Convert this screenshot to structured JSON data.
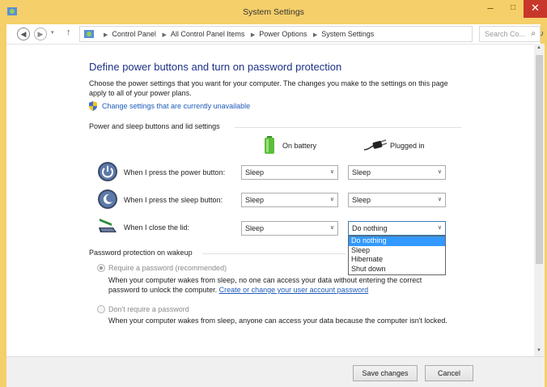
{
  "window": {
    "title": "System Settings",
    "controls": {
      "minimize": "–",
      "maximize": "□",
      "close": "✕"
    }
  },
  "address": {
    "breadcrumbs": [
      "Control Panel",
      "All Control Panel Items",
      "Power Options",
      "System Settings"
    ],
    "search_placeholder": "Search Co..."
  },
  "page": {
    "heading": "Define power buttons and turn on password protection",
    "intro": "Choose the power settings that you want for your computer. The changes you make to the settings on this page apply to all of your power plans.",
    "change_link": "Change settings that are currently unavailable"
  },
  "power_group": {
    "label": "Power and sleep buttons and lid settings",
    "columns": {
      "battery": "On battery",
      "plugged": "Plugged in"
    },
    "rows": [
      {
        "label": "When I press the power button:",
        "icon": "power-button-icon",
        "battery": "Sleep",
        "plugged": "Sleep"
      },
      {
        "label": "When I press the sleep button:",
        "icon": "sleep-button-icon",
        "battery": "Sleep",
        "plugged": "Sleep"
      },
      {
        "label": "When I close the lid:",
        "icon": "laptop-lid-icon",
        "battery": "Sleep",
        "plugged": "Do nothing"
      }
    ],
    "open_dropdown": {
      "options": [
        "Do nothing",
        "Sleep",
        "Hibernate",
        "Shut down"
      ],
      "selected": "Do nothing"
    }
  },
  "password_group": {
    "label": "Password protection on wakeup",
    "require": {
      "label": "Require a password (recommended)",
      "desc_prefix": "When your computer wakes from sleep, no one can access your data without entering the correct password to unlock the computer. ",
      "link": "Create or change your user account password",
      "checked": true
    },
    "no_require": {
      "label": "Don't require a password",
      "desc": "When your computer wakes from sleep, anyone can access your data because the computer isn't locked.",
      "checked": false
    }
  },
  "buttons": {
    "save": "Save changes",
    "cancel": "Cancel"
  },
  "colors": {
    "titlebar": "#f5cf6a",
    "heading": "#1e3287",
    "link": "#1e5bb8",
    "selection": "#3399ff",
    "close": "#c7382a"
  }
}
